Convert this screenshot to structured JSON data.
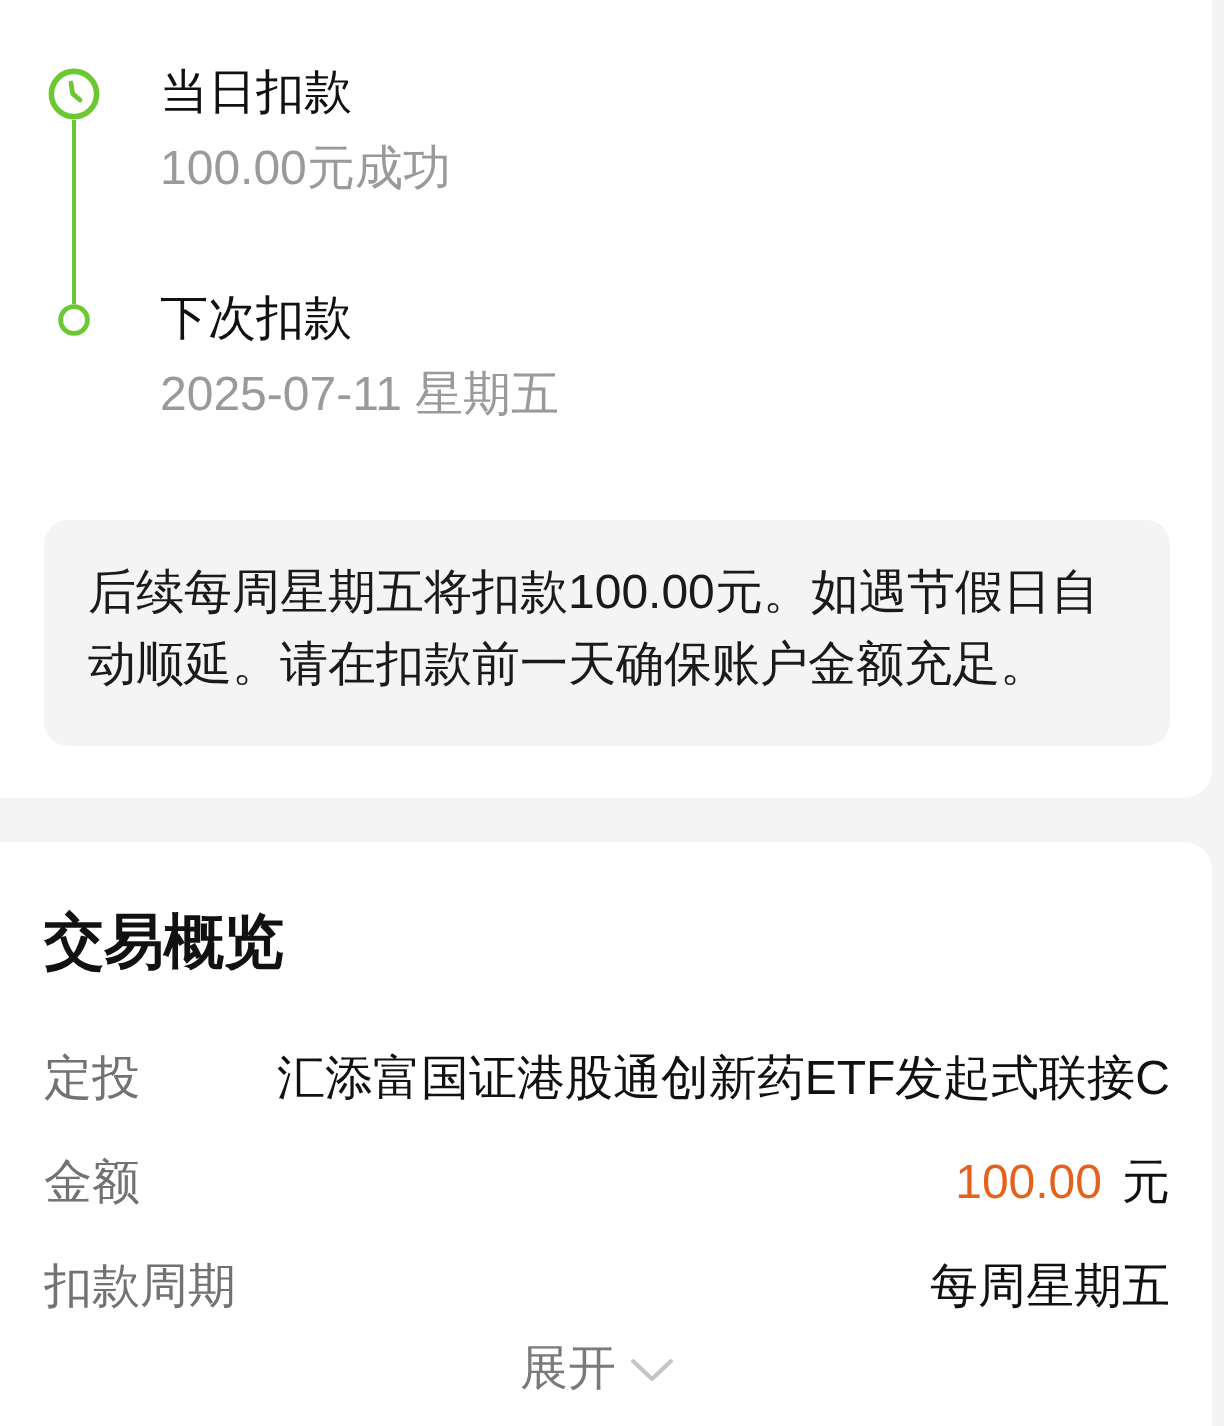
{
  "timeline": [
    {
      "kind": "clock",
      "title": "当日扣款",
      "detail": "100.00元成功"
    },
    {
      "kind": "dot",
      "title": "下次扣款",
      "detail": "2025-07-11 星期五"
    }
  ],
  "notice": "后续每周星期五将扣款100.00元。如遇节假日自动顺延。请在扣款前一天确保账户金额充足。",
  "summary": {
    "title": "交易概览",
    "rows": [
      {
        "kind": "text",
        "label": "定投",
        "value": "汇添富国证港股通创新药ETF发起式联接C"
      },
      {
        "kind": "amount",
        "label": "金额",
        "value": "100.00",
        "unit": "元"
      },
      {
        "kind": "text",
        "label": "扣款周期",
        "value": "每周星期五"
      }
    ],
    "expand_button": "展开"
  }
}
